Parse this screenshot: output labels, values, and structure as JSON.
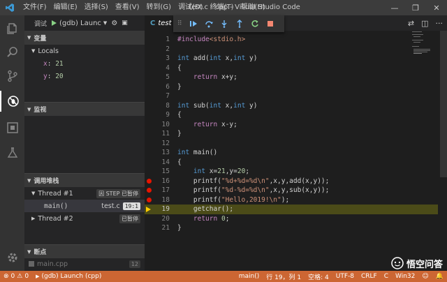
{
  "window": {
    "title": "test.c - cpp - Visual Studio Code",
    "minimize": "—",
    "maximize": "❐",
    "close": "✕"
  },
  "menu": [
    "文件(F)",
    "编辑(E)",
    "选择(S)",
    "查看(V)",
    "转到(G)",
    "调试(D)",
    "终端(T)",
    "帮助(H)"
  ],
  "debug": {
    "panel_title": "调试",
    "config": "(gdb) Launc",
    "sections": {
      "variables": "变量",
      "watch": "监视",
      "callstack": "调用堆栈",
      "breakpoints": "断点"
    },
    "locals_label": "Locals",
    "variables": [
      {
        "name": "x",
        "value": "21"
      },
      {
        "name": "y",
        "value": "20"
      }
    ],
    "threads": [
      {
        "name": "Thread #1",
        "status": "因 STEP 已暂停"
      },
      {
        "name": "Thread #2",
        "status": "已暂停"
      }
    ],
    "frame": {
      "name": "main()",
      "file": "test.c",
      "pos": "19:1"
    },
    "breakpoint_item": {
      "file": "main.cpp",
      "line": "12"
    }
  },
  "editor": {
    "tab_icon": "C",
    "tab_name": "test",
    "code": [
      {
        "n": "1",
        "segs": [
          [
            "inc",
            "#include"
          ],
          [
            "str",
            "<stdio.h>"
          ]
        ]
      },
      {
        "n": "2",
        "segs": []
      },
      {
        "n": "3",
        "segs": [
          [
            "kw",
            "int"
          ],
          [
            "",
            " add("
          ],
          [
            "kw",
            "int"
          ],
          [
            "",
            " x,"
          ],
          [
            "kw",
            "int"
          ],
          [
            "",
            " y)"
          ]
        ]
      },
      {
        "n": "4",
        "segs": [
          [
            "",
            "{"
          ]
        ]
      },
      {
        "n": "5",
        "segs": [
          [
            "",
            "    "
          ],
          [
            "inc",
            "return"
          ],
          [
            "",
            " x+y;"
          ]
        ]
      },
      {
        "n": "6",
        "segs": [
          [
            "",
            "}"
          ]
        ]
      },
      {
        "n": "7",
        "segs": []
      },
      {
        "n": "8",
        "segs": [
          [
            "kw",
            "int"
          ],
          [
            "",
            " sub("
          ],
          [
            "kw",
            "int"
          ],
          [
            "",
            " x,"
          ],
          [
            "kw",
            "int"
          ],
          [
            "",
            " y)"
          ]
        ]
      },
      {
        "n": "9",
        "segs": [
          [
            "",
            "{"
          ]
        ]
      },
      {
        "n": "10",
        "segs": [
          [
            "",
            "    "
          ],
          [
            "inc",
            "return"
          ],
          [
            "",
            " x-y;"
          ]
        ]
      },
      {
        "n": "11",
        "segs": [
          [
            "",
            "}"
          ]
        ]
      },
      {
        "n": "12",
        "segs": []
      },
      {
        "n": "13",
        "segs": [
          [
            "kw",
            "int"
          ],
          [
            "",
            " main()"
          ]
        ]
      },
      {
        "n": "14",
        "segs": [
          [
            "",
            "{"
          ]
        ]
      },
      {
        "n": "15",
        "segs": [
          [
            "",
            "    "
          ],
          [
            "kw",
            "int"
          ],
          [
            "",
            " x="
          ],
          [
            "num",
            "21"
          ],
          [
            "",
            ",y="
          ],
          [
            "num",
            "20"
          ],
          [
            "",
            ";"
          ]
        ]
      },
      {
        "n": "16",
        "bp": true,
        "segs": [
          [
            "",
            "    printf("
          ],
          [
            "str",
            "\"%d+%d=%d\\n\""
          ],
          [
            "",
            ",x,y,add(x,y));"
          ]
        ]
      },
      {
        "n": "17",
        "bp": true,
        "segs": [
          [
            "",
            "    printf("
          ],
          [
            "str",
            "\"%d-%d=%d\\n\""
          ],
          [
            "",
            ",x,y,sub(x,y));"
          ]
        ]
      },
      {
        "n": "18",
        "bp": true,
        "segs": [
          [
            "",
            "    printf("
          ],
          [
            "str",
            "\"Hello,2019!\\n\""
          ],
          [
            "",
            ");"
          ]
        ]
      },
      {
        "n": "19",
        "current": true,
        "segs": [
          [
            "",
            "    getchar();"
          ]
        ]
      },
      {
        "n": "20",
        "segs": [
          [
            "",
            "    "
          ],
          [
            "inc",
            "return"
          ],
          [
            "",
            " "
          ],
          [
            "num",
            "0"
          ],
          [
            "",
            ";"
          ]
        ]
      },
      {
        "n": "21",
        "segs": [
          [
            "",
            "}"
          ]
        ]
      }
    ]
  },
  "status": {
    "errors": "0",
    "warnings": "0",
    "launch": "(gdb) Launch (cpp)",
    "function": "main()",
    "position": "行 19，列 1",
    "spaces": "空格: 4",
    "encoding": "UTF-8",
    "eol": "CRLF",
    "language": "C",
    "platform": "Win32"
  },
  "watermark": "悟空问答",
  "colors": {
    "status_bg": "#cc6633",
    "breakpoint": "#e51400",
    "current_line": "#4b4b18"
  }
}
